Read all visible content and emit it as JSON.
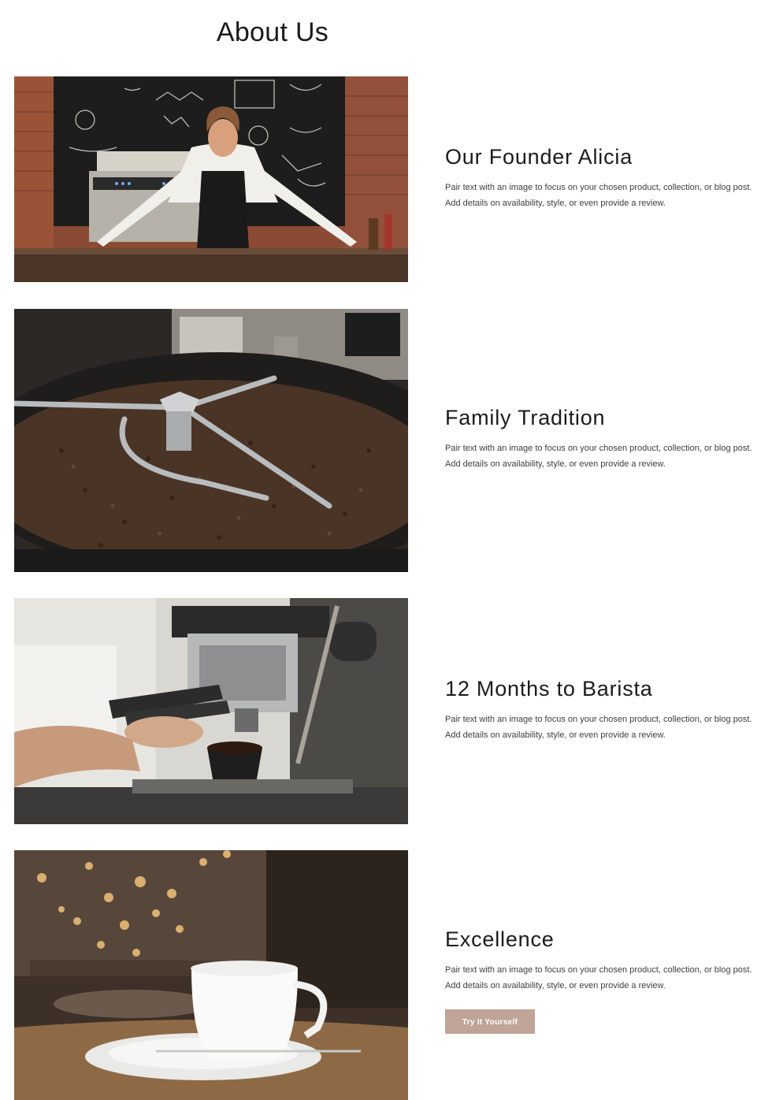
{
  "page": {
    "title": "About Us"
  },
  "sections": [
    {
      "heading": "Our Founder Alicia",
      "body": "Pair text with an image to focus on your chosen product, collection, or blog post. Add details on availability, style, or even provide a review.",
      "image_icon": "barista-at-counter-photo"
    },
    {
      "heading": "Family Tradition",
      "body": "Pair text with an image to focus on your chosen product, collection, or blog post. Add details on availability, style, or even provide a review.",
      "image_icon": "coffee-roaster-photo"
    },
    {
      "heading": "12 Months to Barista",
      "body": "Pair text with an image to focus on your chosen product, collection, or blog post. Add details on availability, style, or even provide a review.",
      "image_icon": "espresso-machine-photo"
    },
    {
      "heading": "Excellence",
      "body": "Pair text with an image to focus on your chosen product, collection, or blog post. Add details on availability, style, or even provide a review.",
      "image_icon": "coffee-cup-photo",
      "button_label": "Try It Yourself"
    }
  ],
  "colors": {
    "button_bg": "#bfa497",
    "text": "#1b1b1b"
  }
}
